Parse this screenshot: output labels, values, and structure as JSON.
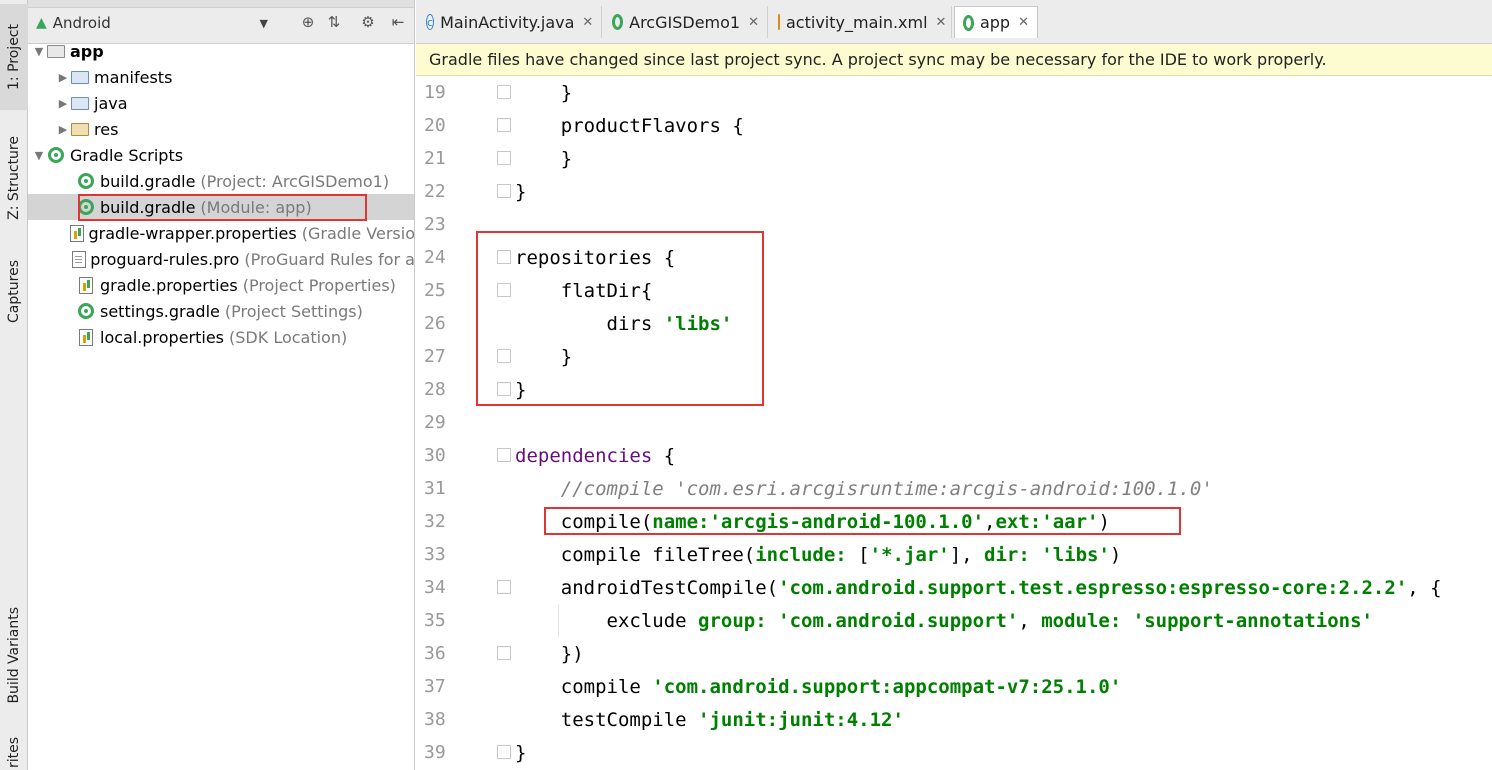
{
  "sidebar_tabs": {
    "project": "1: Project",
    "structure": "Z: Structure",
    "captures": "Captures",
    "build_variants": "Build Variants",
    "favorites": "rites"
  },
  "project_panel": {
    "view_selector": "Android",
    "tree": [
      {
        "label": "app",
        "hint": "",
        "icon": "app-folder-icon"
      },
      {
        "label": "manifests",
        "hint": "",
        "icon": "folder-icon"
      },
      {
        "label": "java",
        "hint": "",
        "icon": "folder-icon"
      },
      {
        "label": "res",
        "hint": "",
        "icon": "res-folder-icon"
      },
      {
        "label": "Gradle Scripts",
        "hint": "",
        "icon": "gradle-icon"
      },
      {
        "label": "build.gradle",
        "hint": "(Project: ArcGISDemo1)",
        "icon": "gradle-icon"
      },
      {
        "label": "build.gradle",
        "hint": "(Module: app)",
        "icon": "gradle-icon"
      },
      {
        "label": "gradle-wrapper.properties",
        "hint": "(Gradle Versio",
        "icon": "properties-icon"
      },
      {
        "label": "proguard-rules.pro",
        "hint": "(ProGuard Rules for a",
        "icon": "file-icon"
      },
      {
        "label": "gradle.properties",
        "hint": "(Project Properties)",
        "icon": "properties-icon"
      },
      {
        "label": "settings.gradle",
        "hint": "(Project Settings)",
        "icon": "gradle-icon"
      },
      {
        "label": "local.properties",
        "hint": "(SDK Location)",
        "icon": "properties-icon"
      }
    ]
  },
  "editor_tabs": [
    {
      "label": "MainActivity.java",
      "icon": "class-icon",
      "active": false
    },
    {
      "label": "ArcGISDemo1",
      "icon": "gradle-icon",
      "active": false
    },
    {
      "label": "activity_main.xml",
      "icon": "xml-icon",
      "active": false
    },
    {
      "label": "app",
      "icon": "gradle-icon",
      "active": true
    }
  ],
  "notice": "Gradle files have changed since last project sync. A project sync may be necessary for the IDE to work properly.",
  "code_lines": [
    {
      "num": "19",
      "parts": [
        {
          "t": "    }",
          "c": ""
        }
      ]
    },
    {
      "num": "20",
      "parts": [
        {
          "t": "    productFlavors {",
          "c": ""
        }
      ]
    },
    {
      "num": "21",
      "parts": [
        {
          "t": "    }",
          "c": ""
        }
      ]
    },
    {
      "num": "22",
      "parts": [
        {
          "t": "}",
          "c": ""
        }
      ]
    },
    {
      "num": "23",
      "parts": []
    },
    {
      "num": "24",
      "parts": [
        {
          "t": "repositories {",
          "c": ""
        }
      ]
    },
    {
      "num": "25",
      "parts": [
        {
          "t": "    flatDir{",
          "c": ""
        }
      ]
    },
    {
      "num": "26",
      "parts": [
        {
          "t": "        dirs ",
          "c": ""
        },
        {
          "t": "'libs'",
          "c": "str"
        }
      ]
    },
    {
      "num": "27",
      "parts": [
        {
          "t": "    }",
          "c": ""
        }
      ]
    },
    {
      "num": "28",
      "parts": [
        {
          "t": "}",
          "c": ""
        }
      ]
    },
    {
      "num": "29",
      "parts": []
    },
    {
      "num": "30",
      "parts": [
        {
          "t": "dependencies",
          "c": "nm"
        },
        {
          "t": " {",
          "c": ""
        }
      ]
    },
    {
      "num": "31",
      "parts": [
        {
          "t": "    //compile 'com.esri.arcgisruntime:arcgis-android:100.1.0'",
          "c": "cm"
        }
      ]
    },
    {
      "num": "32",
      "parts": [
        {
          "t": "    compile(",
          "c": ""
        },
        {
          "t": "name:",
          "c": "str"
        },
        {
          "t": "'arcgis-android-100.1.0'",
          "c": "str"
        },
        {
          "t": ",",
          "c": ""
        },
        {
          "t": "ext:",
          "c": "str"
        },
        {
          "t": "'aar'",
          "c": "str"
        },
        {
          "t": ")",
          "c": ""
        }
      ]
    },
    {
      "num": "33",
      "parts": [
        {
          "t": "    compile fileTree(",
          "c": ""
        },
        {
          "t": "include:",
          "c": "str"
        },
        {
          "t": " [",
          "c": ""
        },
        {
          "t": "'*.jar'",
          "c": "str"
        },
        {
          "t": "], ",
          "c": ""
        },
        {
          "t": "dir:",
          "c": "str"
        },
        {
          "t": " ",
          "c": ""
        },
        {
          "t": "'libs'",
          "c": "str"
        },
        {
          "t": ")",
          "c": ""
        }
      ]
    },
    {
      "num": "34",
      "parts": [
        {
          "t": "    androidTestCompile(",
          "c": ""
        },
        {
          "t": "'com.android.support.test.espresso:espresso-core:2.2.2'",
          "c": "str"
        },
        {
          "t": ", {",
          "c": ""
        }
      ]
    },
    {
      "num": "35",
      "parts": [
        {
          "t": "        exclude ",
          "c": ""
        },
        {
          "t": "group:",
          "c": "str"
        },
        {
          "t": " ",
          "c": ""
        },
        {
          "t": "'com.android.support'",
          "c": "str"
        },
        {
          "t": ", ",
          "c": ""
        },
        {
          "t": "module:",
          "c": "str"
        },
        {
          "t": " ",
          "c": ""
        },
        {
          "t": "'support-annotations'",
          "c": "str"
        }
      ]
    },
    {
      "num": "36",
      "parts": [
        {
          "t": "    })",
          "c": ""
        }
      ]
    },
    {
      "num": "37",
      "parts": [
        {
          "t": "    compile ",
          "c": ""
        },
        {
          "t": "'com.android.support:appcompat-v7:25.1.0'",
          "c": "str"
        }
      ]
    },
    {
      "num": "38",
      "parts": [
        {
          "t": "    testCompile ",
          "c": ""
        },
        {
          "t": "'junit:junit:4.12'",
          "c": "str"
        }
      ]
    },
    {
      "num": "39",
      "parts": [
        {
          "t": "}",
          "c": ""
        }
      ]
    }
  ]
}
